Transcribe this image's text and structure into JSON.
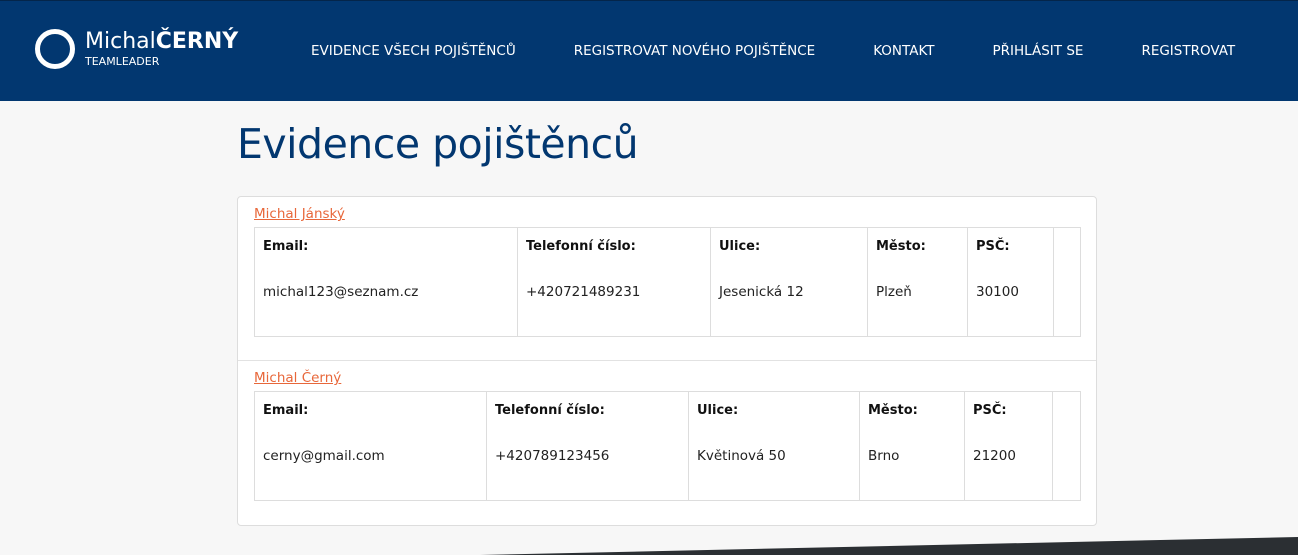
{
  "brand": {
    "first": "Michal",
    "last": "ČERNÝ",
    "subtitle": "TEAMLEADER"
  },
  "nav": {
    "items": [
      {
        "label": "EVIDENCE VŠECH POJIŠTĚNCŮ"
      },
      {
        "label": "REGISTROVAT NOVÉHO POJIŠTĚNCE"
      },
      {
        "label": "KONTAKT"
      },
      {
        "label": "PŘIHLÁSIT SE"
      },
      {
        "label": "REGISTROVAT"
      }
    ]
  },
  "page": {
    "title": "Evidence pojištěnců"
  },
  "labels": {
    "email": "Email:",
    "phone": "Telefonní číslo:",
    "street": "Ulice:",
    "city": "Město:",
    "zip": "PSČ:"
  },
  "insured": [
    {
      "name": "Michal Jánský",
      "email": "michal123@seznam.cz",
      "phone": "+420721489231",
      "street": "Jesenická 12",
      "city": "Plzeň",
      "zip": "30100"
    },
    {
      "name": "Michal Černý",
      "email": "cerny@gmail.com",
      "phone": "+420789123456",
      "street": "Květinová 50",
      "city": "Brno",
      "zip": "21200"
    }
  ],
  "colors": {
    "navbar": "#023770",
    "title": "#023770",
    "link": "#e8673a",
    "wedge": "#2b2f33"
  }
}
